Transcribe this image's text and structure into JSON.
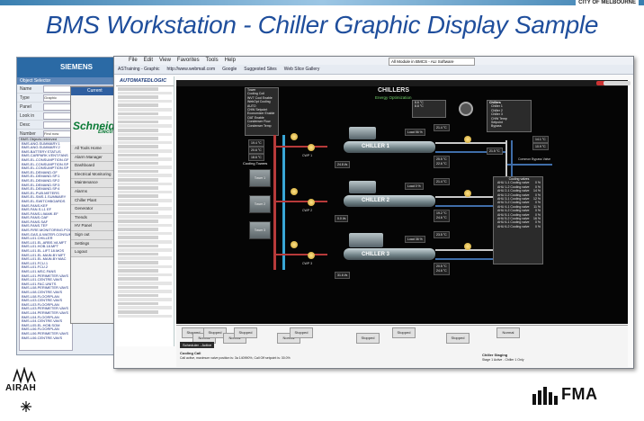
{
  "slide": {
    "title": "BMS Workstation - Chiller Graphic Display Sample",
    "corner_label": "CITY OF MELBOURNE",
    "logo_left": "AIRAH",
    "logo_right": "FMA"
  },
  "siemens_window": {
    "brand": "SIEMENS",
    "section_title": "Object Selector",
    "fields": [
      {
        "label": "Name",
        "value": ""
      },
      {
        "label": "Type",
        "value": "Graphic"
      },
      {
        "label": "Panel",
        "value": ""
      },
      {
        "label": "Look in",
        "value": ""
      },
      {
        "label": "Desc",
        "value": ""
      },
      {
        "label": "Number",
        "value": "Find now"
      }
    ],
    "list_header": "BMS Objects retrieved",
    "list_items": [
      "BMS.ANG.SUMMARY.1",
      "BMS.ANG.SUMMARY.2",
      "BMS.BATTERY.STATUS",
      "BMS.CARPARK.VENT.FANS",
      "BMS.EL.CONSUMPTION.GF",
      "BMS.EL.CONSUMPTION.SP",
      "BMS.EL.CONSUMPTION.SP",
      "BMS.EL.DEMAND.GF",
      "BMS.EL.DEMAND.SP.1",
      "BMS.EL.DEMAND.SP.2",
      "BMS.EL.DEMAND.SP.3",
      "BMS.EL.DEMAND.SP.4",
      "BMS.EL.PUB.METERS",
      "BMS.EL.SMS.1.SUMMARY",
      "BMS.EL.SWITCHBOARDS",
      "BMS.FANS.KEF",
      "BMS.FAN.S.L1 EF",
      "BMS.FANS.L9AMK.EF",
      "BMS.FANS.OAF",
      "BMS.FANS.SAF",
      "BMS.FANS.TEF",
      "BMS.FIRE.MONITORING.POINTS",
      "BMS.GAS.&.WATER.CONSUMPTION",
      "BMS.L01.CHILLER",
      "BMS.L01.EL.ARBS.VA.MFT",
      "BMS.L01.HOB.18.MFT",
      "BMS.L01.EL.LIFT.18.MOS",
      "BMS.L01.EL.MAIN.BY.MFT",
      "BMS.L01.EL.MAIN.BY.MAC",
      "BMS.L01.FCU.1",
      "BMS.L01.FCU.2",
      "BMS.L01.MSC.FANS",
      "BMS.L01.PERIMETER.VAVS",
      "BMS.L01.CENTRE.VAVS",
      "BMS.L01.FAC.UNITS",
      "BMS.L08.PERIMETER.VAVS",
      "BMS.L08.CENTRE.VAVS",
      "BMS.L08.FLOORPLAN",
      "BMS.L03.CENTRE.VAVS",
      "BMS.L03.FLOORPLAN",
      "BMS.L03.PERIMETER.VAVS",
      "BMS.L04.PERIMETER.VAVS",
      "BMS.L04.FLOORPLAN",
      "BMS.L04.CENTRE.VAVS",
      "BMS.L05.EL.HOB.SOM",
      "BMS.L06.FLOORPLAN",
      "BMS.L06.PERIMETER.VAVS",
      "BMS.L06.CENTRE.VAVS"
    ]
  },
  "schneider_window": {
    "tab": "Current",
    "brand": "Schneider",
    "brand_sub": "Electric",
    "menu": [
      "All Tools Home",
      "Alarm Manager",
      "Dashboard",
      "Electrical Monitoring",
      "Maintenance",
      "Alarms",
      "Chiller Plant",
      "Generator",
      "Trends",
      "HV Panel",
      "Sign out",
      "Settings",
      "Logout"
    ]
  },
  "browser": {
    "menu": [
      "File",
      "Edit",
      "View",
      "Favorites",
      "Tools",
      "Help"
    ],
    "favorites": [
      "ASTraining - Graphic",
      "http://www.webmail.com",
      "Google",
      "Suggested Sites",
      "Web Slice Gallery"
    ],
    "tab_label": "All Module in BMCS - ALI Software",
    "sidebar_logo": "AUTOMATEDLOGIC"
  },
  "chiller_display": {
    "header": "CHILLERS",
    "subheader": "Energy Optimization",
    "tower_status": [
      "Tower",
      "Cooling Coil",
      "WVT Cool Enable",
      "WebOpt Cooling",
      "AUTO",
      "CHW Setpoint",
      "Economizer Enable",
      "OAT Enable",
      "Condenser Flow",
      "Condenser Temp"
    ],
    "tower_values": [
      "19.4 °C",
      "20.6 °C",
      "18.6 °C"
    ],
    "towers": [
      "Tower 1",
      "Tower 2",
      "Tower 3"
    ],
    "tower_label": "Cooling Towers",
    "chillers": [
      {
        "name": "CHILLER 1",
        "load": "Load 56 %",
        "status": "Running",
        "actual": "25.5 °C",
        "setpoint": "22.6 °C",
        "return": "21.4 °C",
        "supply": "8.6 °C",
        "flow": "24.8 l/s"
      },
      {
        "name": "CHILLER 2",
        "load": "Load 0 %",
        "status": "Off",
        "actual": "19.2 °C",
        "setpoint": "24.6 °C",
        "return": "21.4 °C",
        "supply": "8.6 °C",
        "flow": "0.0 l/s"
      },
      {
        "name": "CHILLER 3",
        "load": "Load 36 %",
        "status": "Running",
        "actual": "20.5 °C",
        "setpoint": "24.6 °C",
        "return": "23.5 °C",
        "supply": "8.8 °C",
        "flow": "31.6 l/s"
      }
    ],
    "pump_labels": [
      "CWP 1",
      "CWP 2",
      "CWP 3",
      "CHWP 1",
      "CHWP 2",
      "CHWP 3"
    ],
    "right_panel_title": "Chillers",
    "right_panel": [
      "Chiller 1",
      "Chiller 2",
      "Chiller 3",
      "CHW Temp",
      "Setpoint",
      "Bypass"
    ],
    "bypass_label": "Common Bypass Valve",
    "right_readout": "21.5 °C",
    "secondary_supply": [
      "14.1 °C",
      "10.9 °C"
    ],
    "summary_title": "Cooling valves",
    "summary_rows": [
      "AHU 1-1 Cooling valve",
      "AHU 1-2 Cooling valve",
      "AHU 2-1 Cooling valve",
      "AHU 2-2 Cooling valve",
      "AHU 3-1 Cooling valve",
      "AHU 3-2 Cooling valve",
      "AHU 4-1 Cooling valve",
      "AHU 4-2 Cooling valve",
      "AHU 5-1 Cooling valve",
      "AHU 5-2 Cooling valve",
      "AHU 6-1 Cooling valve",
      "AHU 6-2 Cooling valve"
    ],
    "summary_values": [
      "0 %",
      "0 %",
      "14 %",
      "0 %",
      "12 %",
      "0 %",
      "11 %",
      "0 %",
      "0 %",
      "16 %",
      "0 %",
      "0 %"
    ]
  },
  "bottom_strip": {
    "schedule": "Scheduler - Active",
    "cooling_call": "Cooling Call",
    "cooling_note": "Call active, maximum valve position is: 3a 140990%, Call Off setpoint is: 30.0%",
    "boxes": [
      "Stopped",
      "Normal",
      "Stopped",
      "Normal",
      "Stopped",
      "Normal",
      "Stopped",
      "Stopped",
      "Stopped",
      "Stopped",
      "Normal"
    ],
    "staging": "Chiller Staging",
    "staging_note": "Stage 1 Active - Chiller 1 Only"
  }
}
